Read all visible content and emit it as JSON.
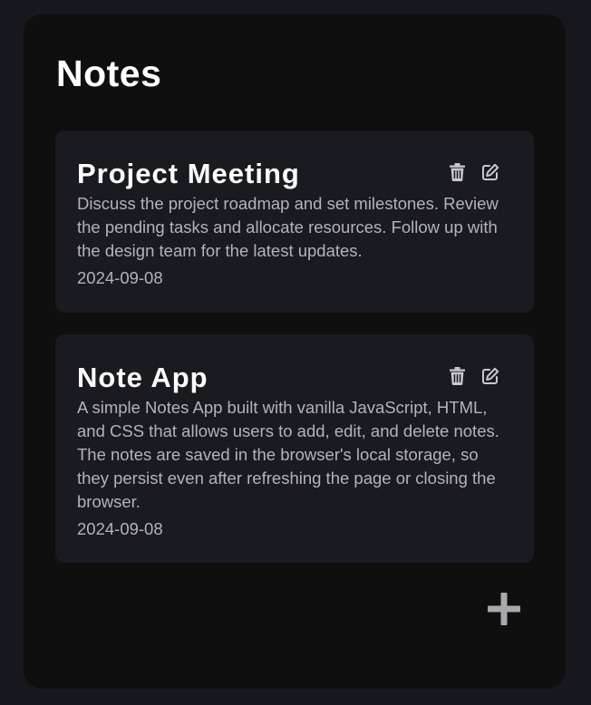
{
  "app": {
    "title": "Notes"
  },
  "notes": [
    {
      "title": "Project Meeting",
      "body": "Discuss the project roadmap and set milestones. Review the pending tasks and allocate resources. Follow up with the design team for the latest updates.",
      "date": "2024-09-08"
    },
    {
      "title": "Note App",
      "body": "A simple Notes App built with vanilla JavaScript, HTML, and CSS that allows users to add, edit, and delete notes. The notes are saved in the browser's local storage, so they persist even after refreshing the page or closing the browser.",
      "date": "2024-09-08"
    }
  ],
  "icons": {
    "delete": "trash-icon",
    "edit": "edit-icon",
    "add": "plus-icon"
  },
  "colors": {
    "page_background": "#17181d",
    "app_background": "#0f0f0f",
    "card_background": "#1a1b21",
    "title_text": "#ffffff",
    "body_text": "#b3b3b9",
    "icon": "#c8c8cc",
    "add_icon": "#a9a9ad"
  }
}
